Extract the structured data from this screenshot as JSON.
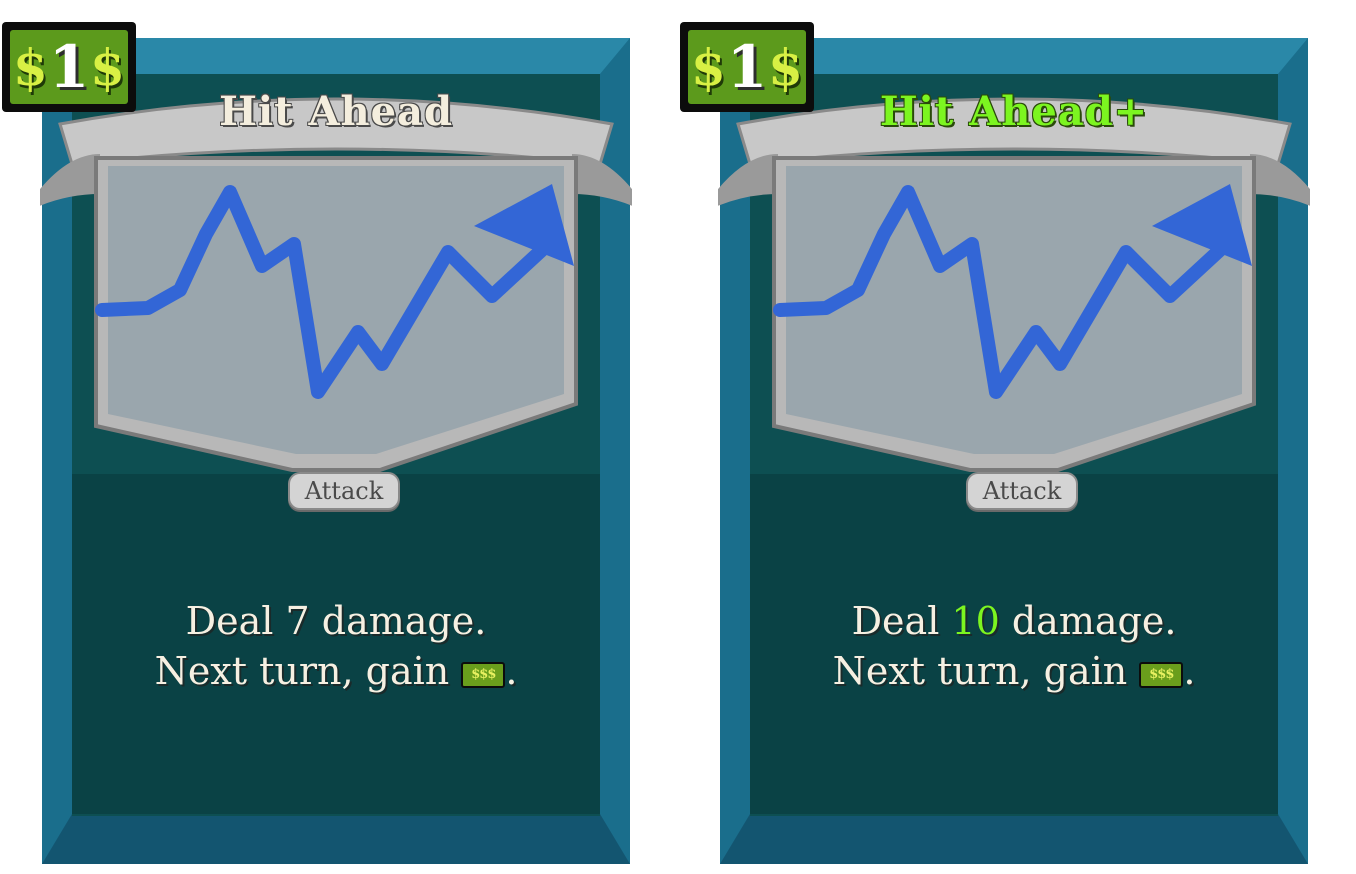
{
  "cards": [
    {
      "cost_sign_left": "$",
      "cost": "1",
      "cost_sign_right": "$",
      "title": "Hit Ahead",
      "type": "Attack",
      "desc_line1_pre": "Deal ",
      "desc_damage": "7",
      "desc_line1_post": " damage.",
      "desc_line2_pre": "Next turn, gain ",
      "desc_money_icon": "$$$",
      "desc_line2_post": "."
    },
    {
      "cost_sign_left": "$",
      "cost": "1",
      "cost_sign_right": "$",
      "title": "Hit Ahead+",
      "type": "Attack",
      "desc_line1_pre": "Deal ",
      "desc_damage": "10",
      "desc_line1_post": " damage.",
      "desc_line2_pre": "Next turn, gain ",
      "desc_money_icon": "$$$",
      "desc_line2_post": "."
    }
  ],
  "colors": {
    "card_border": "#1a6e8c",
    "card_body": "#0d4f52",
    "art_bg": "#9aa6ad",
    "arrow": "#3366d6",
    "upgrade_text": "#7cf520",
    "cost_bg": "#5c9a1c"
  },
  "icons": [
    "dollar-icon",
    "stock-arrow-icon",
    "money-icon"
  ]
}
